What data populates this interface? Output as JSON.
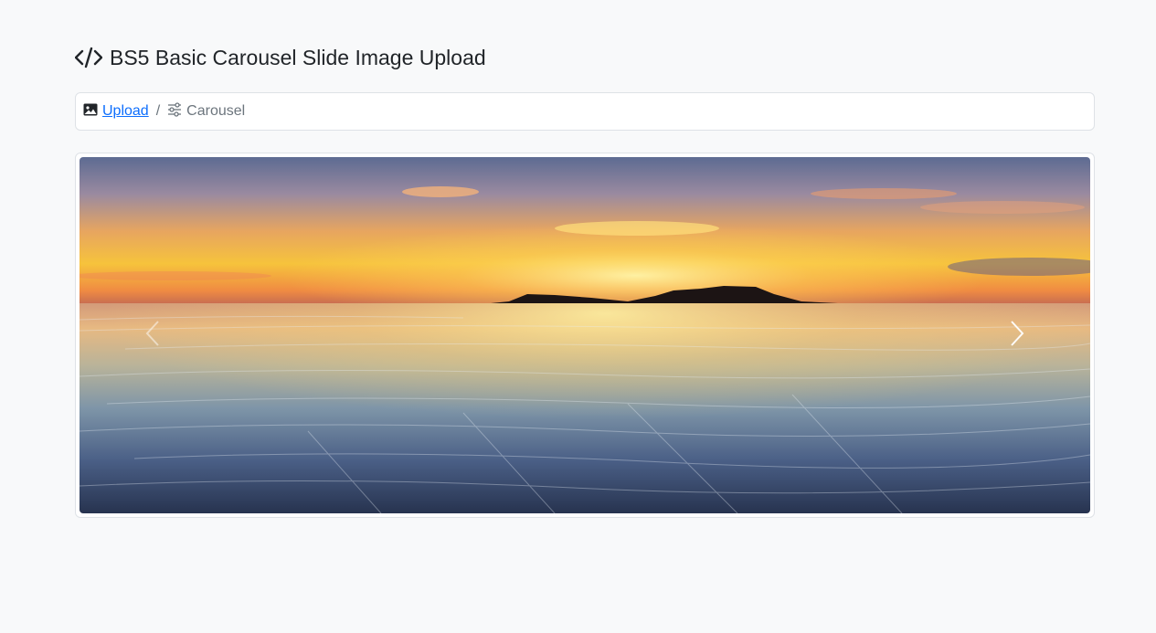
{
  "page": {
    "title": "BS5 Basic Carousel Slide Image Upload",
    "title_icon": "code-icon"
  },
  "breadcrumb": {
    "items": [
      {
        "label": "Upload",
        "icon": "image-icon",
        "link": true
      },
      {
        "label": "Carousel",
        "icon": "sliders-icon",
        "link": false
      }
    ],
    "separator": "/"
  },
  "carousel": {
    "slide_image": "seascape-sunset-beach",
    "prev_icon": "chevron-left-icon",
    "next_icon": "chevron-right-icon"
  },
  "colors": {
    "background": "#f8f9fa",
    "link": "#0d6efd",
    "muted": "#6c757d",
    "border": "#dee2e6"
  }
}
